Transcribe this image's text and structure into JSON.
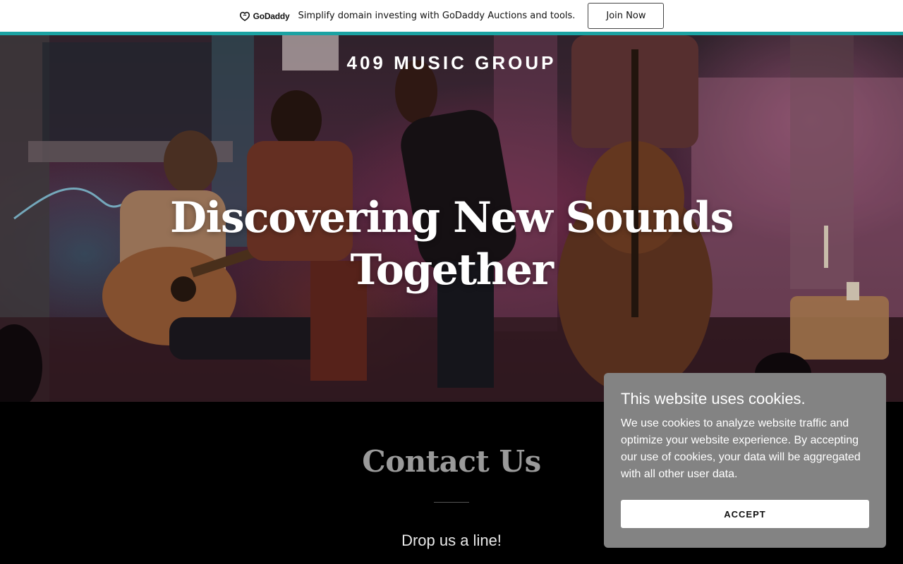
{
  "promo": {
    "logo_text": "GoDaddy",
    "message": "Simplify domain investing with GoDaddy Auctions and tools.",
    "cta_label": "Join Now"
  },
  "hero": {
    "brand": "409 MUSIC GROUP",
    "headline": "Discovering New Sounds Together"
  },
  "contact": {
    "title": "Contact Us",
    "tagline": "Drop us a line!"
  },
  "cookie_banner": {
    "title": "This website uses cookies.",
    "body": "We use cookies to analyze website traffic and optimize your website experience. By accepting our use of cookies, your data will be aggregated with all other user data.",
    "accept_label": "ACCEPT"
  },
  "colors": {
    "accent_bar": "#1ba3a3",
    "cookie_bg": "#838383",
    "contact_title": "#9a9a9a"
  }
}
